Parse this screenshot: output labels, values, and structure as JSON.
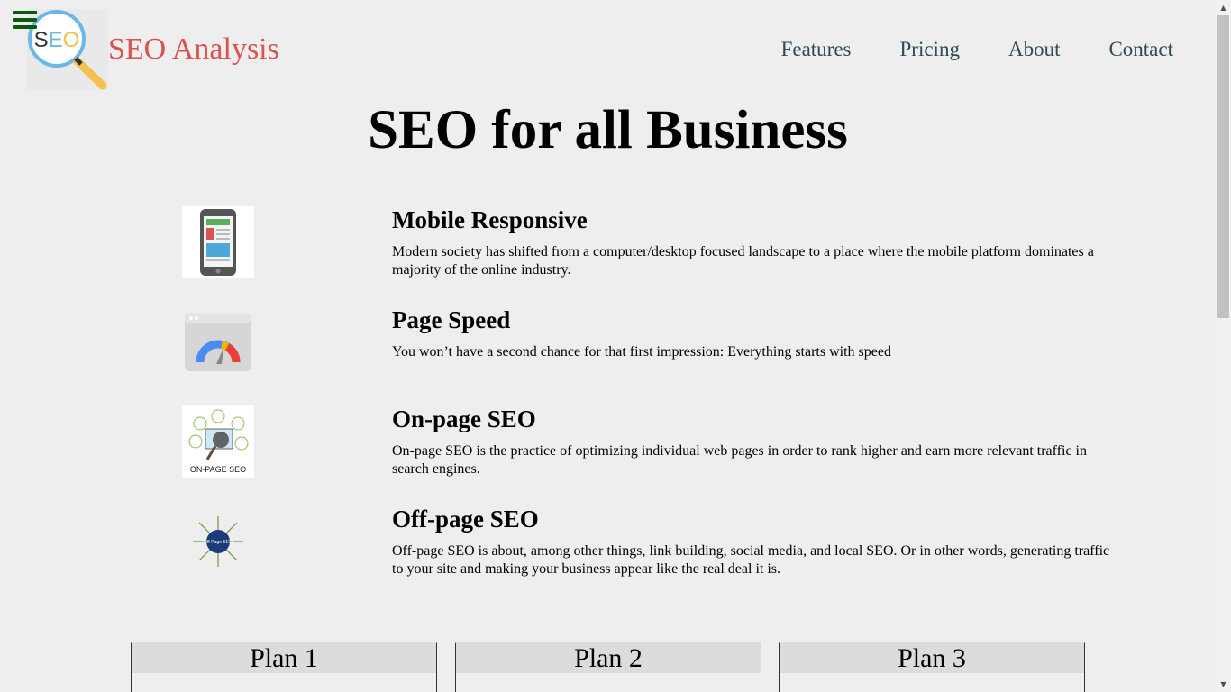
{
  "header": {
    "brand": "SEO Analysis",
    "logo_text": "SEO",
    "nav": [
      "Features",
      "Pricing",
      "About",
      "Contact"
    ]
  },
  "hero": {
    "title": "SEO for all Business"
  },
  "features": [
    {
      "title": "Mobile Responsive",
      "text": "Modern society has shifted from a computer/desktop focused landscape to a place where the mobile platform dominates a majority of the online industry."
    },
    {
      "title": "Page Speed",
      "text": "You won’t have a second chance for that first impression: Everything starts with speed"
    },
    {
      "title": "On-page SEO",
      "text": "On-page SEO is the practice of optimizing individual web pages in order to rank higher and earn more relevant traffic in search engines.",
      "image_caption": "ON-PAGE SEO"
    },
    {
      "title": "Off-page SEO",
      "text": "Off-page SEO is about, among other things, link building, social media, and local SEO. Or in other words, generating traffic to your site and making your business appear like the real deal it is.",
      "image_caption": "Off-Page SEO"
    }
  ],
  "plans": [
    "Plan 1",
    "Plan 2",
    "Plan 3"
  ],
  "colors": {
    "background": "#eeeeee",
    "brand": "#d9534f",
    "nav": "#2d4a5a",
    "menu": "#0b5a0b",
    "plan_header": "#dcdcdc"
  },
  "icons": {
    "menu": "hamburger-icon",
    "logo": "magnifier-logo",
    "feature_1": "mobile-phone-icon",
    "feature_2": "speed-gauge-icon",
    "feature_3": "on-page-seo-icon",
    "feature_4": "off-page-seo-icon"
  }
}
